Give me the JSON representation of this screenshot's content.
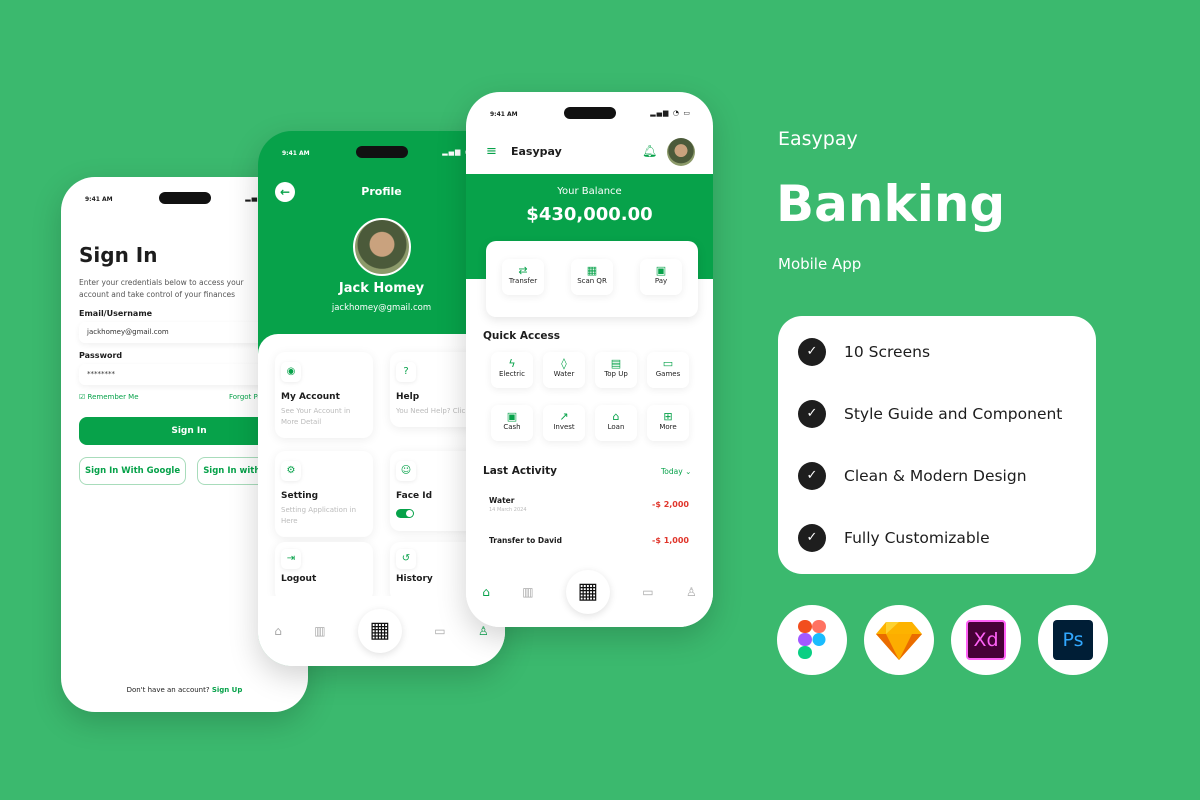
{
  "brand": "Easypay",
  "headline": "Banking",
  "subtitle": "Mobile App",
  "features": [
    "10 Screens",
    "Style Guide and Component",
    "Clean & Modern Design",
    "Fully Customizable"
  ],
  "tools": [
    {
      "name": "Figma",
      "label": ""
    },
    {
      "name": "Sketch",
      "label": ""
    },
    {
      "name": "Adobe XD",
      "label": "Xd"
    },
    {
      "name": "Photoshop",
      "label": "Ps"
    }
  ],
  "time": "9:41 AM",
  "signin": {
    "title": "Sign In",
    "desc": "Enter your credentials below to access your account and take control of your finances",
    "email_label": "Email/Username",
    "email_value": "jackhomey@gmail.com",
    "password_label": "Password",
    "password_value": "********",
    "remember": "Remember Me",
    "forgot": "Forgot Password?",
    "button": "Sign In",
    "google": "Sign In With Google",
    "apple": "Sign In with Apple",
    "footer": "Don't have an account?",
    "signup": "Sign Up"
  },
  "profile": {
    "title": "Profile",
    "name": "Jack Homey",
    "email": "jackhomey@gmail.com",
    "cards": [
      {
        "title": "My Account",
        "desc": "See Your Account in More Detail"
      },
      {
        "title": "Help",
        "desc": "You Need Help? Click Here"
      },
      {
        "title": "Setting",
        "desc": "Setting Application in Here"
      },
      {
        "title": "Face Id",
        "desc": ""
      },
      {
        "title": "Logout",
        "desc": ""
      },
      {
        "title": "History",
        "desc": ""
      }
    ],
    "face_id_enabled": true
  },
  "home": {
    "app_name": "Easypay",
    "balance_label": "Your Balance",
    "balance": "$430,000.00",
    "actions": [
      "Transfer",
      "Scan QR",
      "Pay"
    ],
    "quick_title": "Quick Access",
    "quick": [
      "Electric",
      "Water",
      "Top Up",
      "Games",
      "Cash",
      "Invest",
      "Loan",
      "More"
    ],
    "activity_title": "Last Activity",
    "filter": "Today",
    "activity": [
      {
        "title": "Water",
        "date": "14 March 2024",
        "amount": "-$ 2,000"
      },
      {
        "title": "Transfer to David",
        "date": "",
        "amount": "-$ 1,000"
      }
    ]
  },
  "colors": {
    "background": "#3bb96e",
    "primary": "#07a24a",
    "negative": "#e0352b"
  }
}
